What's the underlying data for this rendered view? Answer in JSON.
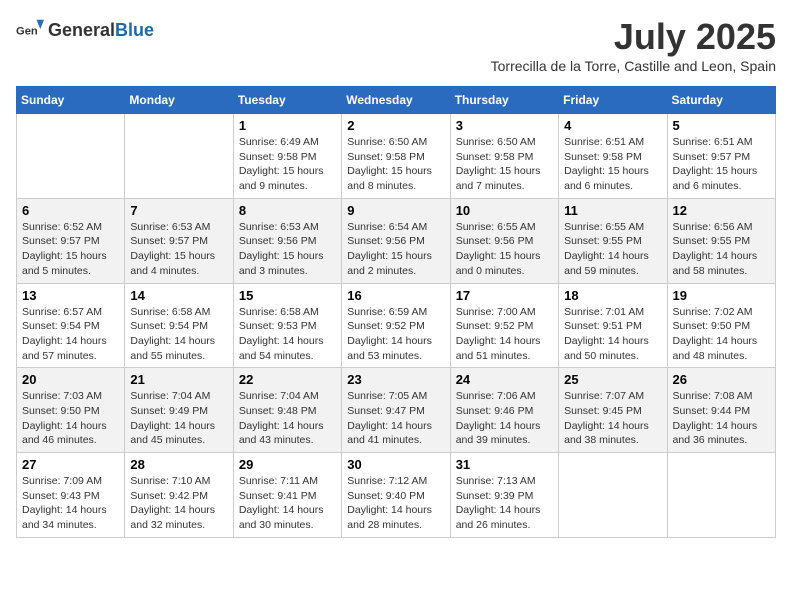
{
  "header": {
    "logo_general": "General",
    "logo_blue": "Blue",
    "month_title": "July 2025",
    "subtitle": "Torrecilla de la Torre, Castille and Leon, Spain"
  },
  "days_of_week": [
    "Sunday",
    "Monday",
    "Tuesday",
    "Wednesday",
    "Thursday",
    "Friday",
    "Saturday"
  ],
  "weeks": [
    [
      {
        "day": "",
        "sunrise": "",
        "sunset": "",
        "daylight": ""
      },
      {
        "day": "",
        "sunrise": "",
        "sunset": "",
        "daylight": ""
      },
      {
        "day": "1",
        "sunrise": "Sunrise: 6:49 AM",
        "sunset": "Sunset: 9:58 PM",
        "daylight": "Daylight: 15 hours and 9 minutes."
      },
      {
        "day": "2",
        "sunrise": "Sunrise: 6:50 AM",
        "sunset": "Sunset: 9:58 PM",
        "daylight": "Daylight: 15 hours and 8 minutes."
      },
      {
        "day": "3",
        "sunrise": "Sunrise: 6:50 AM",
        "sunset": "Sunset: 9:58 PM",
        "daylight": "Daylight: 15 hours and 7 minutes."
      },
      {
        "day": "4",
        "sunrise": "Sunrise: 6:51 AM",
        "sunset": "Sunset: 9:58 PM",
        "daylight": "Daylight: 15 hours and 6 minutes."
      },
      {
        "day": "5",
        "sunrise": "Sunrise: 6:51 AM",
        "sunset": "Sunset: 9:57 PM",
        "daylight": "Daylight: 15 hours and 6 minutes."
      }
    ],
    [
      {
        "day": "6",
        "sunrise": "Sunrise: 6:52 AM",
        "sunset": "Sunset: 9:57 PM",
        "daylight": "Daylight: 15 hours and 5 minutes."
      },
      {
        "day": "7",
        "sunrise": "Sunrise: 6:53 AM",
        "sunset": "Sunset: 9:57 PM",
        "daylight": "Daylight: 15 hours and 4 minutes."
      },
      {
        "day": "8",
        "sunrise": "Sunrise: 6:53 AM",
        "sunset": "Sunset: 9:56 PM",
        "daylight": "Daylight: 15 hours and 3 minutes."
      },
      {
        "day": "9",
        "sunrise": "Sunrise: 6:54 AM",
        "sunset": "Sunset: 9:56 PM",
        "daylight": "Daylight: 15 hours and 2 minutes."
      },
      {
        "day": "10",
        "sunrise": "Sunrise: 6:55 AM",
        "sunset": "Sunset: 9:56 PM",
        "daylight": "Daylight: 15 hours and 0 minutes."
      },
      {
        "day": "11",
        "sunrise": "Sunrise: 6:55 AM",
        "sunset": "Sunset: 9:55 PM",
        "daylight": "Daylight: 14 hours and 59 minutes."
      },
      {
        "day": "12",
        "sunrise": "Sunrise: 6:56 AM",
        "sunset": "Sunset: 9:55 PM",
        "daylight": "Daylight: 14 hours and 58 minutes."
      }
    ],
    [
      {
        "day": "13",
        "sunrise": "Sunrise: 6:57 AM",
        "sunset": "Sunset: 9:54 PM",
        "daylight": "Daylight: 14 hours and 57 minutes."
      },
      {
        "day": "14",
        "sunrise": "Sunrise: 6:58 AM",
        "sunset": "Sunset: 9:54 PM",
        "daylight": "Daylight: 14 hours and 55 minutes."
      },
      {
        "day": "15",
        "sunrise": "Sunrise: 6:58 AM",
        "sunset": "Sunset: 9:53 PM",
        "daylight": "Daylight: 14 hours and 54 minutes."
      },
      {
        "day": "16",
        "sunrise": "Sunrise: 6:59 AM",
        "sunset": "Sunset: 9:52 PM",
        "daylight": "Daylight: 14 hours and 53 minutes."
      },
      {
        "day": "17",
        "sunrise": "Sunrise: 7:00 AM",
        "sunset": "Sunset: 9:52 PM",
        "daylight": "Daylight: 14 hours and 51 minutes."
      },
      {
        "day": "18",
        "sunrise": "Sunrise: 7:01 AM",
        "sunset": "Sunset: 9:51 PM",
        "daylight": "Daylight: 14 hours and 50 minutes."
      },
      {
        "day": "19",
        "sunrise": "Sunrise: 7:02 AM",
        "sunset": "Sunset: 9:50 PM",
        "daylight": "Daylight: 14 hours and 48 minutes."
      }
    ],
    [
      {
        "day": "20",
        "sunrise": "Sunrise: 7:03 AM",
        "sunset": "Sunset: 9:50 PM",
        "daylight": "Daylight: 14 hours and 46 minutes."
      },
      {
        "day": "21",
        "sunrise": "Sunrise: 7:04 AM",
        "sunset": "Sunset: 9:49 PM",
        "daylight": "Daylight: 14 hours and 45 minutes."
      },
      {
        "day": "22",
        "sunrise": "Sunrise: 7:04 AM",
        "sunset": "Sunset: 9:48 PM",
        "daylight": "Daylight: 14 hours and 43 minutes."
      },
      {
        "day": "23",
        "sunrise": "Sunrise: 7:05 AM",
        "sunset": "Sunset: 9:47 PM",
        "daylight": "Daylight: 14 hours and 41 minutes."
      },
      {
        "day": "24",
        "sunrise": "Sunrise: 7:06 AM",
        "sunset": "Sunset: 9:46 PM",
        "daylight": "Daylight: 14 hours and 39 minutes."
      },
      {
        "day": "25",
        "sunrise": "Sunrise: 7:07 AM",
        "sunset": "Sunset: 9:45 PM",
        "daylight": "Daylight: 14 hours and 38 minutes."
      },
      {
        "day": "26",
        "sunrise": "Sunrise: 7:08 AM",
        "sunset": "Sunset: 9:44 PM",
        "daylight": "Daylight: 14 hours and 36 minutes."
      }
    ],
    [
      {
        "day": "27",
        "sunrise": "Sunrise: 7:09 AM",
        "sunset": "Sunset: 9:43 PM",
        "daylight": "Daylight: 14 hours and 34 minutes."
      },
      {
        "day": "28",
        "sunrise": "Sunrise: 7:10 AM",
        "sunset": "Sunset: 9:42 PM",
        "daylight": "Daylight: 14 hours and 32 minutes."
      },
      {
        "day": "29",
        "sunrise": "Sunrise: 7:11 AM",
        "sunset": "Sunset: 9:41 PM",
        "daylight": "Daylight: 14 hours and 30 minutes."
      },
      {
        "day": "30",
        "sunrise": "Sunrise: 7:12 AM",
        "sunset": "Sunset: 9:40 PM",
        "daylight": "Daylight: 14 hours and 28 minutes."
      },
      {
        "day": "31",
        "sunrise": "Sunrise: 7:13 AM",
        "sunset": "Sunset: 9:39 PM",
        "daylight": "Daylight: 14 hours and 26 minutes."
      },
      {
        "day": "",
        "sunrise": "",
        "sunset": "",
        "daylight": ""
      },
      {
        "day": "",
        "sunrise": "",
        "sunset": "",
        "daylight": ""
      }
    ]
  ]
}
